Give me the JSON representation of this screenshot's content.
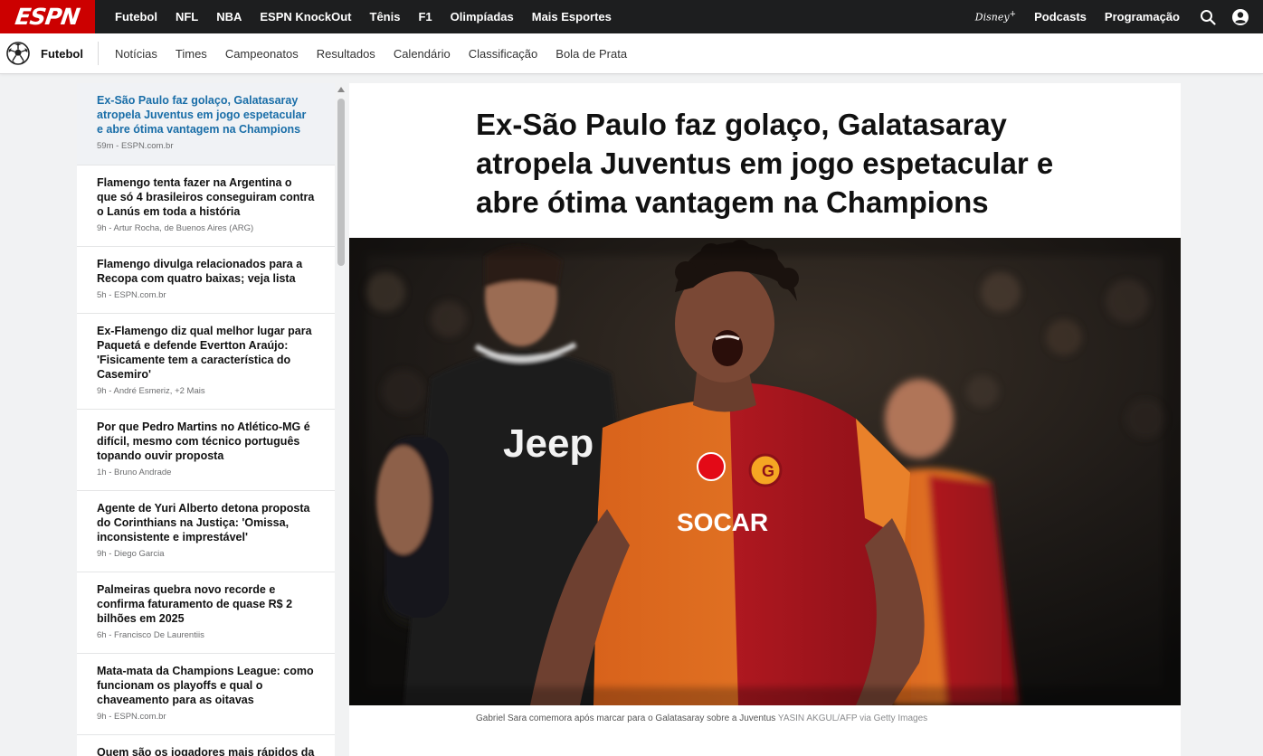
{
  "brand": {
    "logo_text": "ESPN",
    "accent": "#cc0000"
  },
  "topnav": {
    "items": [
      "Futebol",
      "NFL",
      "NBA",
      "ESPN KnockOut",
      "Tênis",
      "F1",
      "Olimpíadas",
      "Mais Esportes"
    ],
    "right": {
      "disney": "Disney",
      "disney_plus": "+",
      "podcasts": "Podcasts",
      "programacao": "Programação"
    }
  },
  "subnav": {
    "section": "Futebol",
    "items": [
      "Notícias",
      "Times",
      "Campeonatos",
      "Resultados",
      "Calendário",
      "Classificação",
      "Bola de Prata"
    ]
  },
  "sidebar": {
    "stories": [
      {
        "title": "Ex-São Paulo faz golaço, Galatasaray atropela Juventus em jogo espetacular e abre ótima vantagem na Champions",
        "time": "59m",
        "source": "ESPN.com.br"
      },
      {
        "title": "Flamengo tenta fazer na Argentina o que só 4 brasileiros conseguiram contra o Lanús em toda a história",
        "time": "9h",
        "source": "Artur Rocha, de Buenos Aires (ARG)"
      },
      {
        "title": "Flamengo divulga relacionados para a Recopa com quatro baixas; veja lista",
        "time": "5h",
        "source": "ESPN.com.br"
      },
      {
        "title": "Ex-Flamengo diz qual melhor lugar para Paquetá e defende Evertton Araújo: 'Fisicamente tem a característica do Casemiro'",
        "time": "9h",
        "source": "André Esmeriz, +2 Mais"
      },
      {
        "title": "Por que Pedro Martins no Atlético-MG é difícil, mesmo com técnico português topando ouvir proposta",
        "time": "1h",
        "source": "Bruno Andrade"
      },
      {
        "title": "Agente de Yuri Alberto detona proposta do Corinthians na Justiça: 'Omissa, inconsistente e imprestável'",
        "time": "9h",
        "source": "Diego Garcia"
      },
      {
        "title": "Palmeiras quebra novo recorde e confirma faturamento de quase R$ 2 bilhões em 2025",
        "time": "6h",
        "source": "Francisco De Laurentiis"
      },
      {
        "title": "Mata-mata da Champions League: como funcionam os playoffs e qual o chaveamento para as oitavas",
        "time": "9h",
        "source": "ESPN.com.br"
      },
      {
        "title": "Quem são os jogadores mais rápidos da",
        "time": "",
        "source": ""
      }
    ]
  },
  "article": {
    "headline": "Ex-São Paulo faz golaço, Galatasaray atropela Juventus em jogo espetacular e abre ótima vantagem na Champions",
    "caption": "Gabriel Sara comemora após marcar para o Galatasaray sobre a Juventus",
    "credit_agency": "YASIN AKGUL/AFP",
    "credit_via": "via Getty Images",
    "photo_text": {
      "sponsor_left": "Jeep",
      "sponsor_right": "SOCAR"
    }
  }
}
